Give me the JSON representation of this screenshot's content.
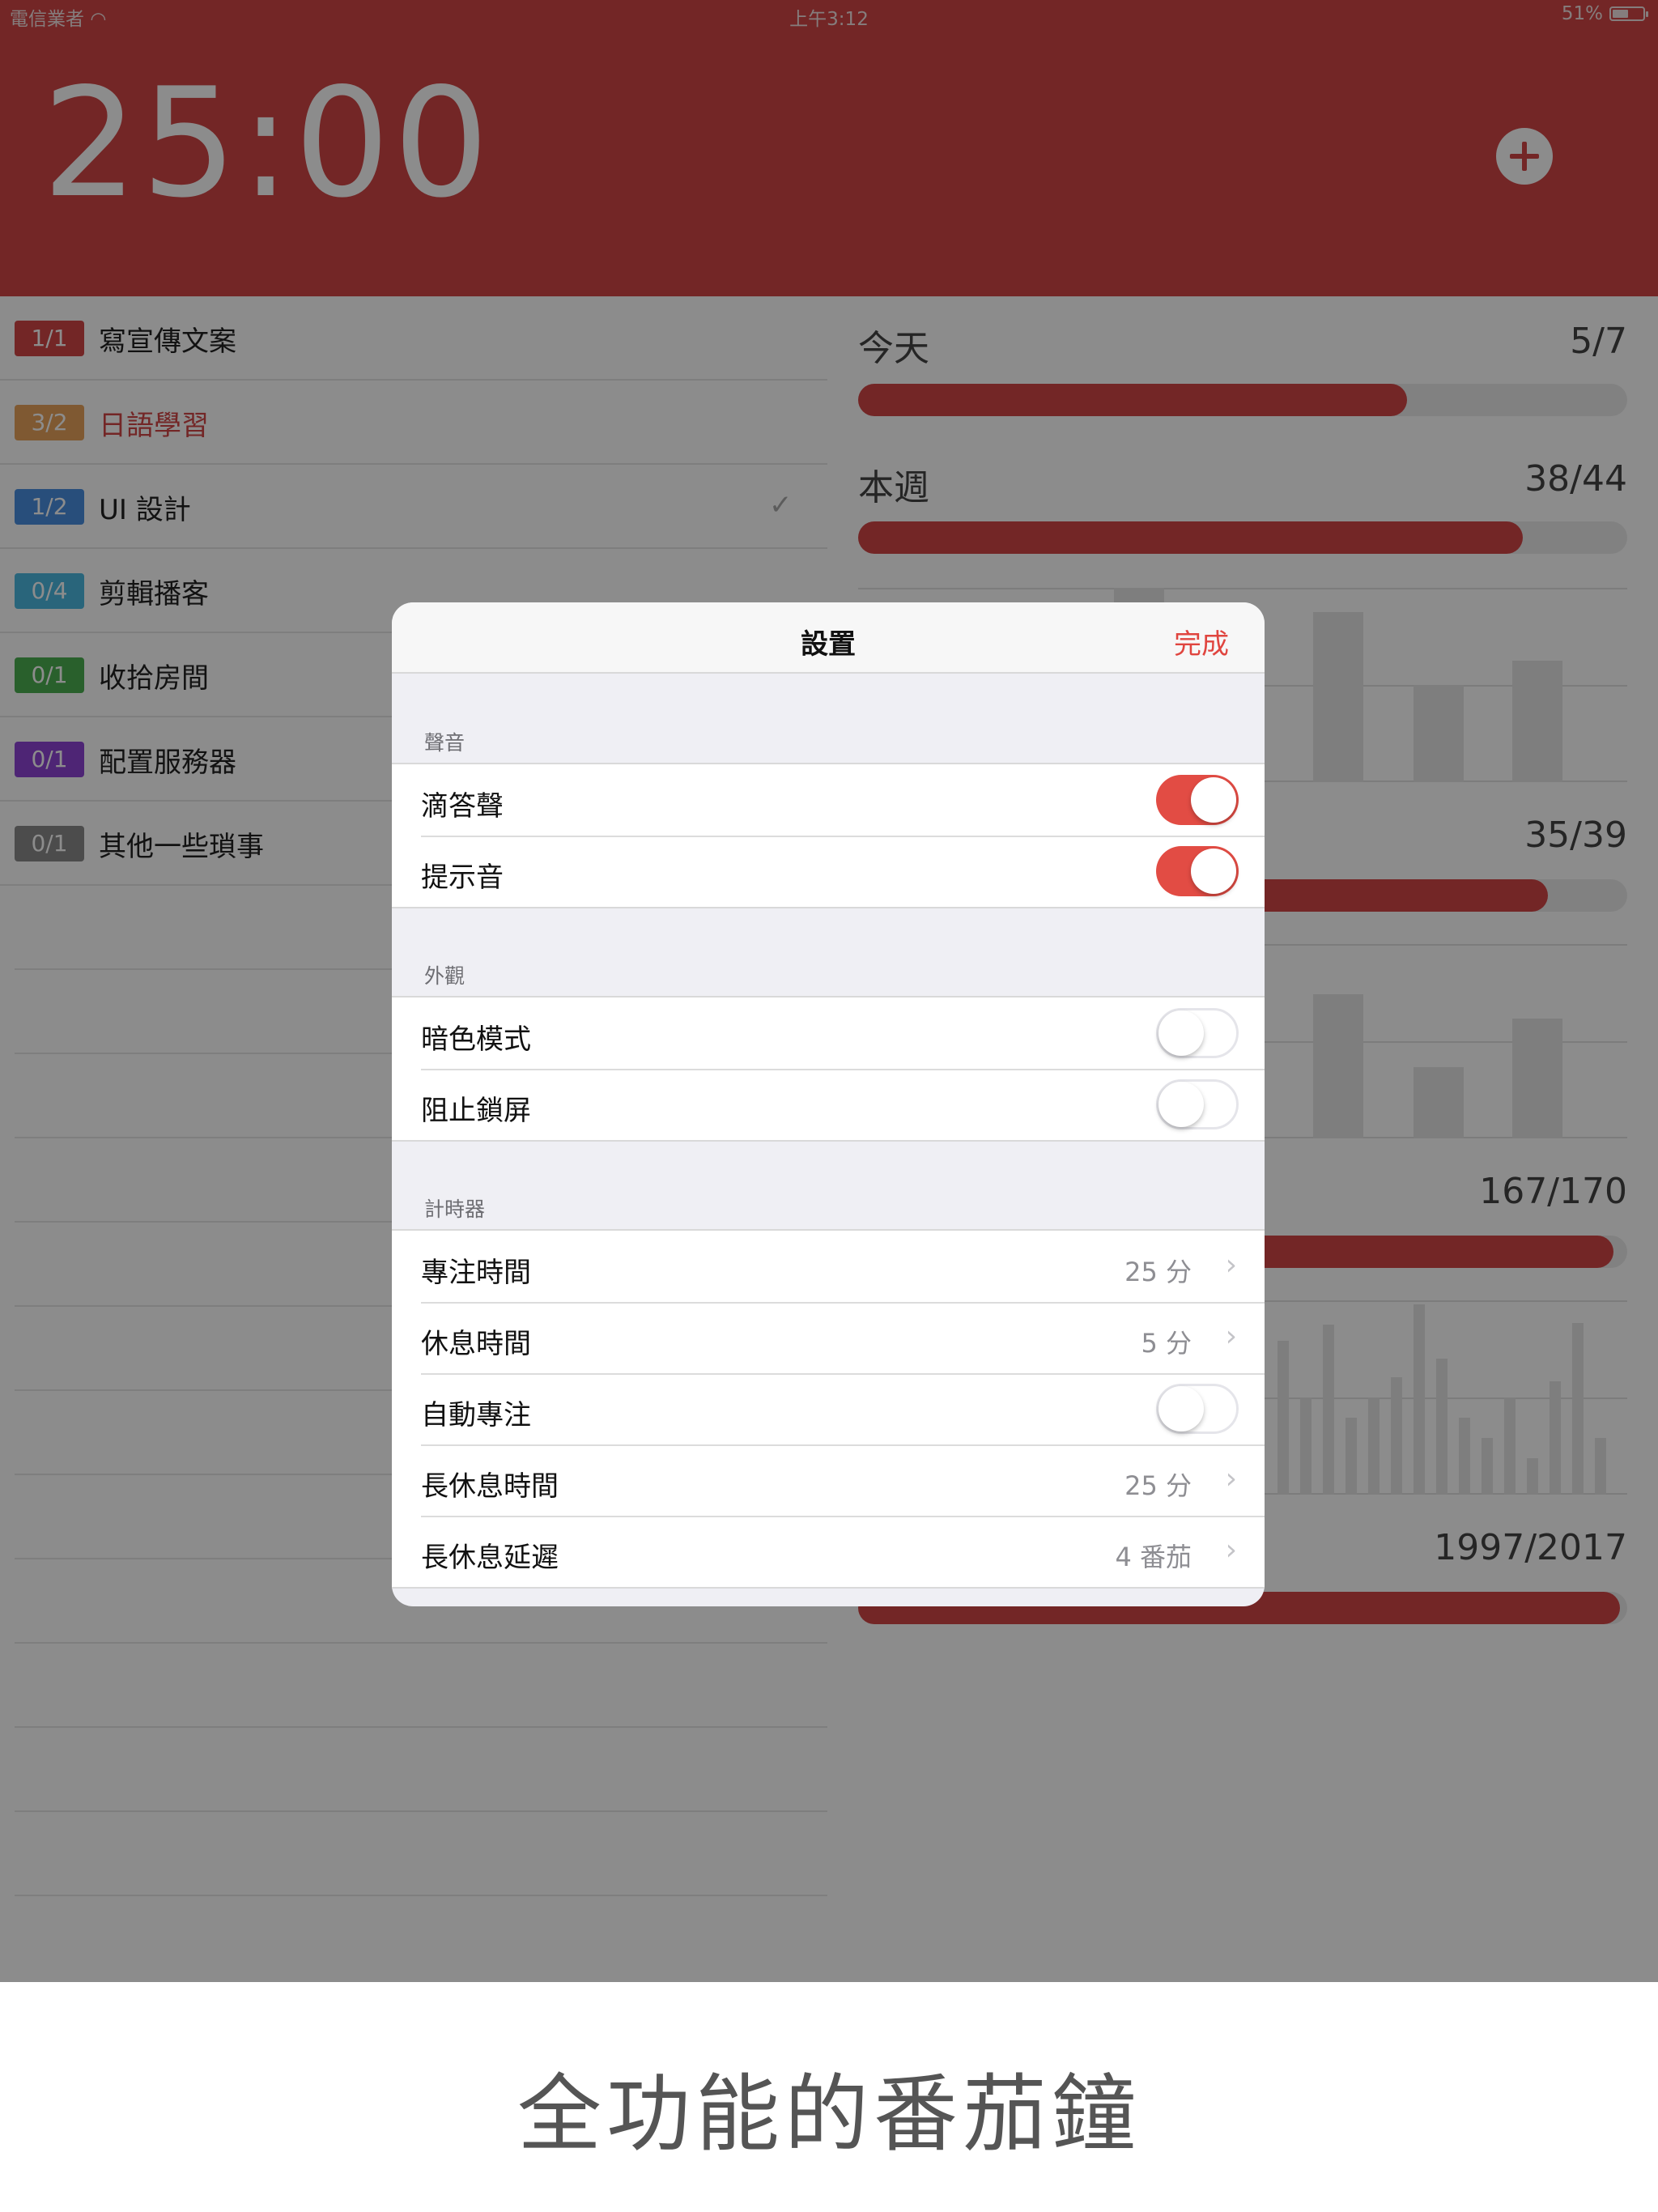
{
  "status_bar": {
    "carrier": "電信業者",
    "time": "上午3:12",
    "battery": "51%"
  },
  "header": {
    "timer": "25:00",
    "add_icon": "plus-circle-icon"
  },
  "tasks": [
    {
      "count": "1/1",
      "label": "寫宣傳文案",
      "color": "#d14545",
      "checked": false
    },
    {
      "count": "3/2",
      "label": "日語學習",
      "color": "#e8a35b",
      "checked": false,
      "label_color": "#d14545"
    },
    {
      "count": "1/2",
      "label": "UI 設計",
      "color": "#4a8fe0",
      "checked": true
    },
    {
      "count": "0/4",
      "label": "剪輯播客",
      "color": "#4cb8e0",
      "checked": false
    },
    {
      "count": "0/1",
      "label": "收拾房間",
      "color": "#4caf50",
      "checked": false
    },
    {
      "count": "0/1",
      "label": "配置服務器",
      "color": "#8e44d6",
      "checked": false
    },
    {
      "count": "0/1",
      "label": "其他一些瑣事",
      "color": "#8a8a8a",
      "checked": false
    }
  ],
  "stats": {
    "today": {
      "title": "今天",
      "value": "5/7",
      "progress": 0.714
    },
    "week": {
      "title": "本週",
      "value": "38/44",
      "progress": 0.864
    },
    "month": {
      "value": "35/39",
      "progress": 0.897
    },
    "year": {
      "value": "167/170",
      "progress": 0.982
    },
    "total": {
      "value": "1997/2017",
      "progress": 0.99
    }
  },
  "settings": {
    "title": "設置",
    "done": "完成",
    "sections": {
      "sound": {
        "label": "聲音",
        "rows": [
          {
            "label": "滴答聲",
            "toggle": true
          },
          {
            "label": "提示音",
            "toggle": true
          }
        ]
      },
      "appearance": {
        "label": "外觀",
        "rows": [
          {
            "label": "暗色模式",
            "toggle": false
          },
          {
            "label": "阻止鎖屏",
            "toggle": false
          }
        ]
      },
      "timer": {
        "label": "計時器",
        "rows": [
          {
            "label": "專注時間",
            "value": "25 分"
          },
          {
            "label": "休息時間",
            "value": "5 分"
          },
          {
            "label": "自動專注",
            "toggle": false
          },
          {
            "label": "長休息時間",
            "value": "25 分"
          },
          {
            "label": "長休息延遲",
            "value": "4 番茄"
          }
        ]
      }
    }
  },
  "caption": "全功能的番茄鐘",
  "colors": {
    "accent": "#d14545",
    "toggle_on": "#e24c44"
  }
}
